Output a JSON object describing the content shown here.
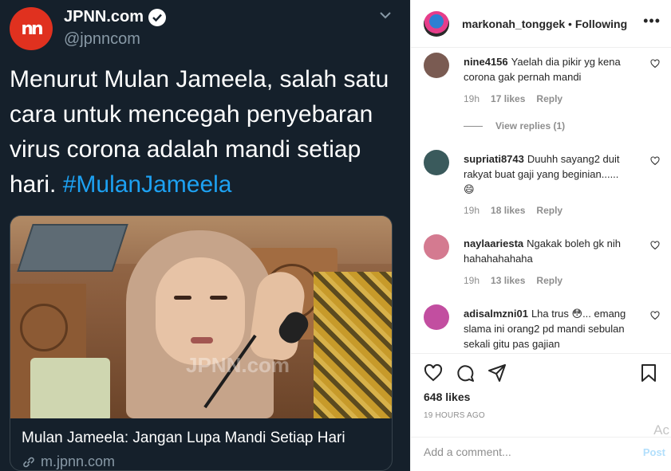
{
  "tweet": {
    "display_name": "JPNN.com",
    "handle": "@jpnncom",
    "text": "Menurut Mulan Jameela, salah satu cara untuk mencegah penyebaran virus corona adalah mandi setiap hari.",
    "hashtag": "#MulanJameela",
    "photo_watermark": "JPNN.com",
    "card_title": "Mulan Jameela: Jangan Lupa Mandi Setiap Hari",
    "card_link": "m.jpnn.com",
    "logo_text": "nn"
  },
  "instagram": {
    "header": {
      "username": "markonah_tonggek",
      "separator": " • ",
      "follow_status": "Following",
      "more": "•••"
    },
    "comments": [
      {
        "username": "nine4156",
        "text": "Yaelah dia pikir yg kena corona gak pernah mandi",
        "time": "19h",
        "likes": "17 likes",
        "reply": "Reply",
        "view_replies": "View replies (1)",
        "avatar_color": "#7a5b52"
      },
      {
        "username": "supriati8743",
        "text": "Duuhh sayang2 duit rakyat buat gaji yang beginian......",
        "emoji": "😄",
        "time": "19h",
        "likes": "18 likes",
        "reply": "Reply",
        "avatar_color": "#3a5a5c"
      },
      {
        "username": "naylaariesta",
        "text": "Ngakak boleh gk nih hahahahahaha",
        "time": "19h",
        "likes": "13 likes",
        "reply": "Reply",
        "avatar_color": "#d47a90"
      },
      {
        "username": "adisalmzni01",
        "text": "Lha trus 😳... emang slama ini orang2 pd mandi sebulan sekali gitu pas gajian",
        "avatar_color": "#c24ea0"
      }
    ],
    "likes_count": "648 likes",
    "time_ago": "19 HOURS AGO",
    "add_comment_placeholder": "Add a comment...",
    "post_label": "Post",
    "activate_overlay": "Ac"
  },
  "colors": {
    "tweet_bg": "#15202b",
    "twitter_blue": "#1da1f2",
    "ig_text": "#262626",
    "ig_muted": "#8e8e8e"
  }
}
